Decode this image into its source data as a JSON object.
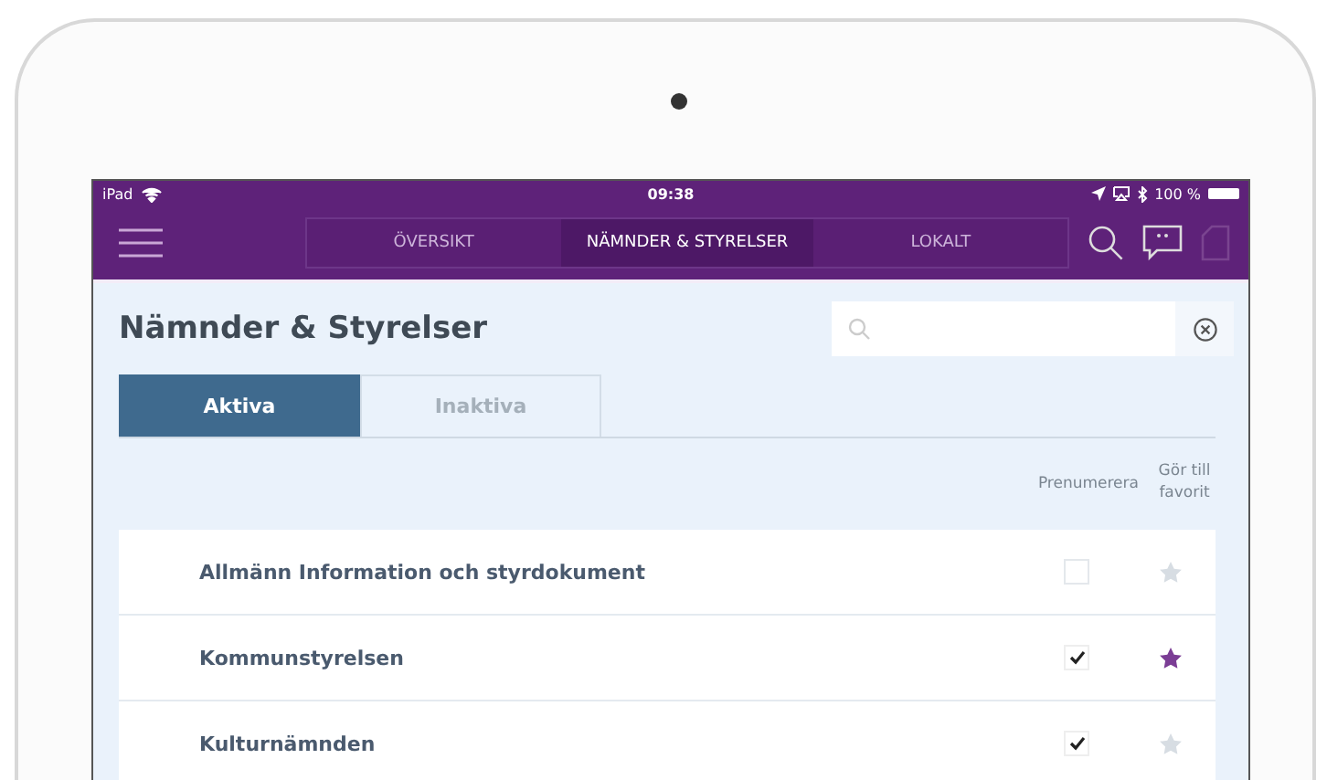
{
  "status_bar": {
    "device": "iPad",
    "time": "09:38",
    "battery": "100 %"
  },
  "nav": {
    "tabs": [
      {
        "label": "ÖVERSIKT",
        "selected": false
      },
      {
        "label": "NÄMNDER & STYRELSER",
        "selected": true
      },
      {
        "label": "LOKALT",
        "selected": false
      }
    ]
  },
  "page": {
    "title": "Nämnder & Styrelser"
  },
  "tabs": [
    {
      "label": "Aktiva",
      "selected": true
    },
    {
      "label": "Inaktiva",
      "selected": false
    }
  ],
  "columns": {
    "subscribe": "Prenumerera",
    "favorite": "Gör till favorit"
  },
  "rows": [
    {
      "name": "Allmänn Information och styrdokument",
      "subscribed": false,
      "favorite": false
    },
    {
      "name": "Kommunstyrelsen",
      "subscribed": true,
      "favorite": true
    },
    {
      "name": "Kulturnämnden",
      "subscribed": true,
      "favorite": false
    }
  ]
}
